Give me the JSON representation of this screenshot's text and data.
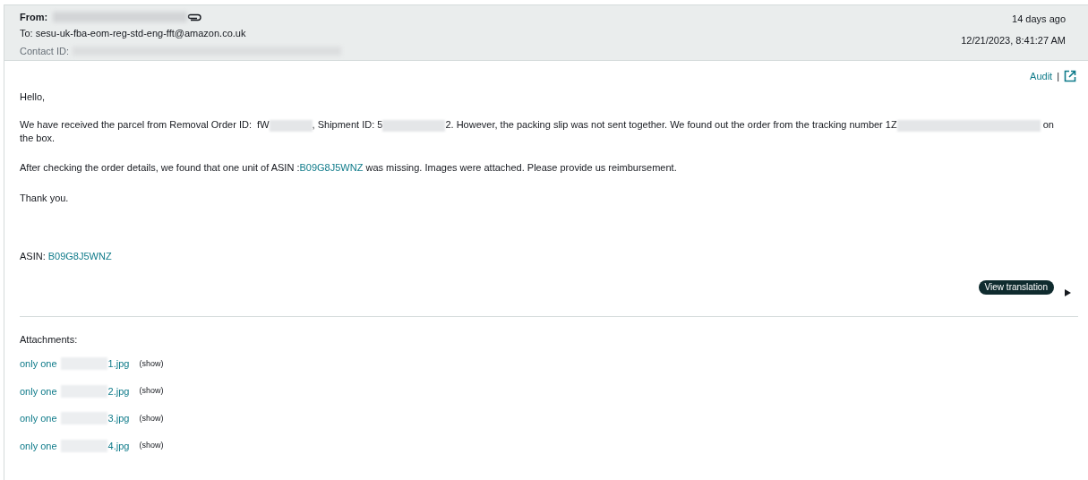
{
  "header": {
    "from_label": "From:",
    "to": "To: sesu-uk-fba-eom-reg-std-eng-fft@amazon.co.uk",
    "contact_label": "Contact ID:",
    "age": "14 days ago",
    "timestamp": "12/21/2023, 8:41:27 AM"
  },
  "actions": {
    "audit": "Audit",
    "separator": "|"
  },
  "body": {
    "greeting": "Hello,",
    "paragraph_1": [
      {
        "kind": "text",
        "text": "We have received the parcel from Removal Order ID:  fW"
      },
      {
        "kind": "redacted"
      },
      {
        "kind": "text",
        "text": ", Shipment ID: 5"
      },
      {
        "kind": "redacted"
      },
      {
        "kind": "text",
        "text": "2. However, the packing slip was not sent together. We found out the order from the tracking number 1Z"
      },
      {
        "kind": "redacted"
      },
      {
        "kind": "text",
        "text": " on"
      },
      {
        "kind": "break"
      },
      {
        "kind": "text",
        "text": "the box."
      }
    ],
    "paragraph_2": {
      "before": "After checking the order details, we found that one unit of ASIN :",
      "link": "B09G8J5WNZ",
      "after": " was missing. Images were attached. Please provide us reimbursement."
    },
    "closing": "Thank you.",
    "asin_label": "ASIN:",
    "asin_link": "B09G8J5WNZ"
  },
  "translation_button": "View translation",
  "attachments": {
    "title": "Attachments:",
    "items": [
      {
        "prefix": "only one",
        "suffix": "1.jpg",
        "action": "(show)"
      },
      {
        "prefix": "only one",
        "suffix": "2.jpg",
        "action": "(show)"
      },
      {
        "prefix": "only one",
        "suffix": "3.jpg",
        "action": "(show)"
      },
      {
        "prefix": "only one",
        "suffix": "4.jpg",
        "action": "(show)"
      }
    ]
  }
}
